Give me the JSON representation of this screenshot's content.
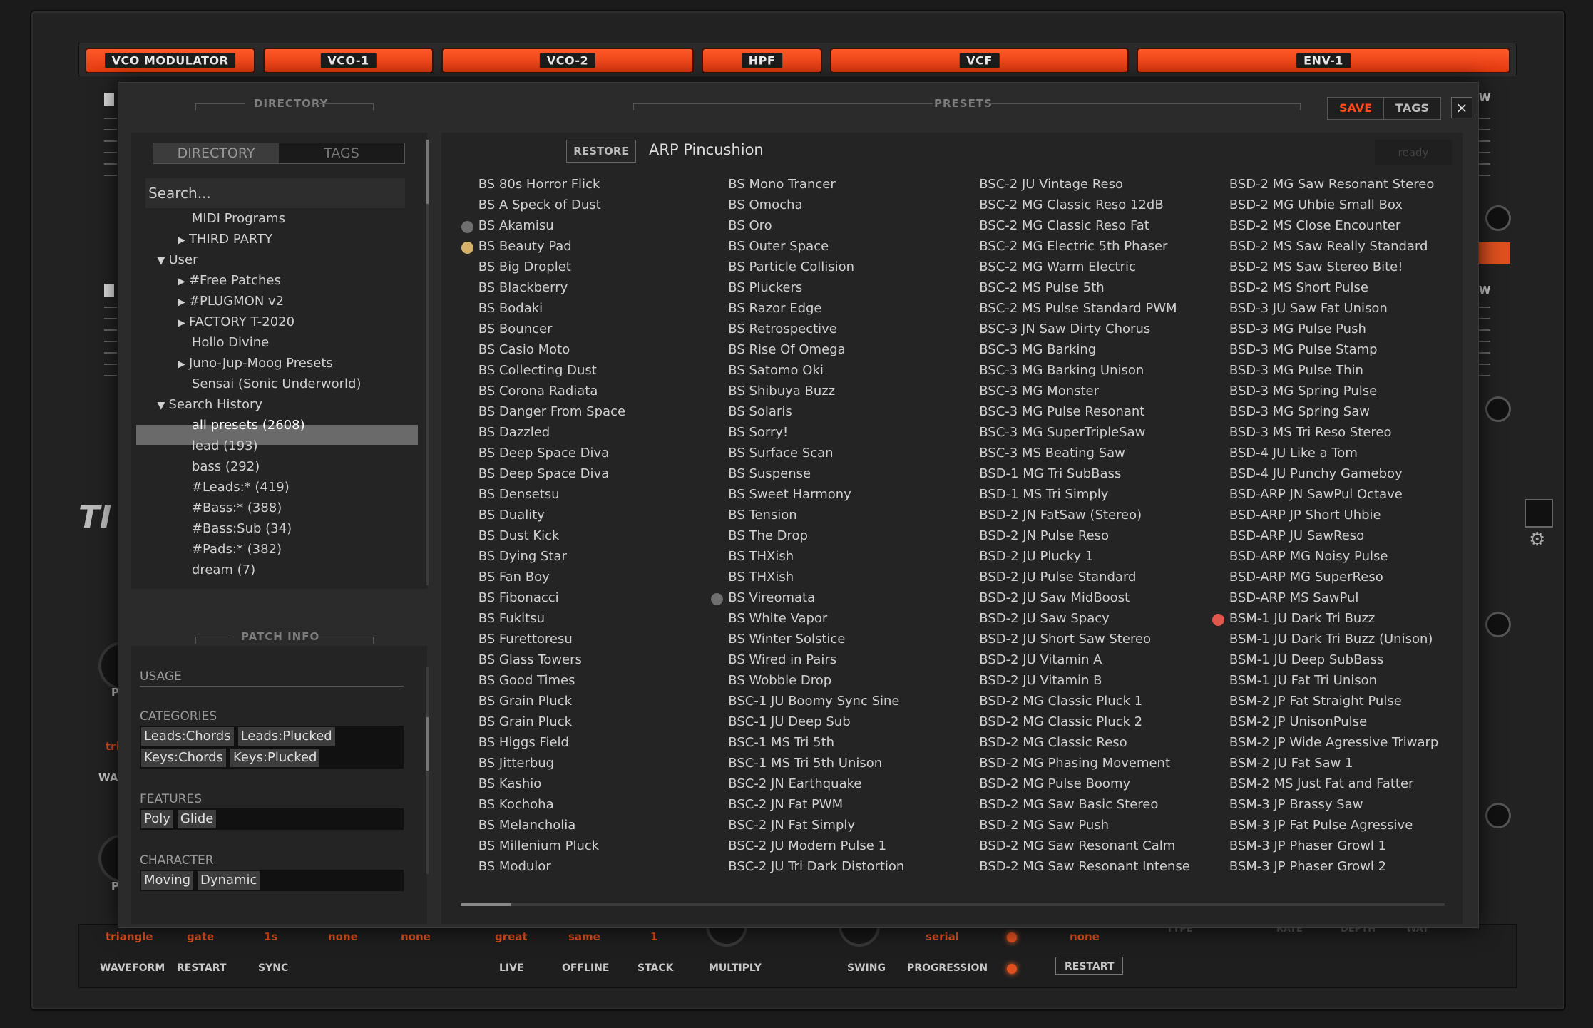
{
  "module_tabs": [
    "VCO MODULATOR",
    "VCO-1",
    "VCO-2",
    "HPF",
    "VCF",
    "ENV-1"
  ],
  "background": {
    "side_letters": [
      "W",
      "W"
    ],
    "left_wave_labels": [
      "tri",
      "WA",
      "P",
      "P"
    ],
    "bottom_values": [
      "triangle",
      "gate",
      "1s",
      "none",
      "none",
      "great",
      "same",
      "1",
      "serial",
      "none"
    ],
    "bottom_labels": [
      "WAVEFORM",
      "RESTART",
      "SYNC",
      "LIVE",
      "OFFLINE",
      "STACK",
      "MULTIPLY",
      "SWING",
      "PROGRESSION",
      "RESTART"
    ],
    "right_labels": [
      "TYPE",
      "RATE",
      "DEPTH",
      "WAY"
    ]
  },
  "browser": {
    "directory_title": "DIRECTORY",
    "presets_title": "PRESETS",
    "patch_info_title": "PATCH INFO",
    "save_label": "SAVE",
    "tags_label": "TAGS",
    "close_label": "×",
    "dir_tab_directory": "DIRECTORY",
    "dir_tab_tags": "TAGS",
    "search_placeholder": "Search...",
    "tree": [
      {
        "label": "MIDI Programs",
        "arrow": ""
      },
      {
        "label": "THIRD PARTY",
        "arrow": "▶"
      },
      {
        "label": "User",
        "arrow": "▼"
      },
      {
        "label": "#Free Patches",
        "arrow": "▶"
      },
      {
        "label": "#PLUGMON v2",
        "arrow": "▶"
      },
      {
        "label": "FACTORY T-2020",
        "arrow": "▶"
      },
      {
        "label": "Hollo Divine",
        "arrow": ""
      },
      {
        "label": "Juno-Jup-Moog Presets",
        "arrow": "▶"
      },
      {
        "label": "Sensai (Sonic Underworld)",
        "arrow": ""
      },
      {
        "label": "Search History",
        "arrow": "▼"
      },
      {
        "label": "all presets (2608)",
        "arrow": ""
      },
      {
        "label": "lead (193)",
        "arrow": ""
      },
      {
        "label": "bass (292)",
        "arrow": ""
      },
      {
        "label": "#Leads:* (419)",
        "arrow": ""
      },
      {
        "label": "#Bass:* (388)",
        "arrow": ""
      },
      {
        "label": "#Bass:Sub (34)",
        "arrow": ""
      },
      {
        "label": "#Pads:* (382)",
        "arrow": ""
      },
      {
        "label": "dream (7)",
        "arrow": ""
      }
    ],
    "patch_info": {
      "usage_label": "USAGE",
      "categories_label": "CATEGORIES",
      "categories": [
        "Leads:Chords",
        "Leads:Plucked",
        "Keys:Chords",
        "Keys:Plucked"
      ],
      "features_label": "FEATURES",
      "features": [
        "Poly",
        "Glide"
      ],
      "character_label": "CHARACTER",
      "character": [
        "Moving",
        "Dynamic"
      ]
    },
    "restore_label": "RESTORE",
    "current_preset": "ARP Pincushion",
    "status": "ready",
    "columns": [
      [
        "BS 80s Horror Flick",
        "BS A Speck of Dust",
        "BS Akamisu",
        "BS Beauty Pad",
        "BS Big Droplet",
        "BS Blackberry",
        "BS Bodaki",
        "BS Bouncer",
        "BS Casio Moto",
        "BS Collecting Dust",
        "BS Corona Radiata",
        "BS Danger From Space",
        "BS Dazzled",
        "BS Deep Space Diva",
        "BS Deep Space Diva",
        "BS Densetsu",
        "BS Duality",
        "BS Dust Kick",
        "BS Dying Star",
        "BS Fan Boy",
        "BS Fibonacci",
        "BS Fukitsu",
        "BS Furettoresu",
        "BS Glass Towers",
        "BS Good Times",
        "BS Grain Pluck",
        "BS Grain Pluck",
        "BS Higgs Field",
        "BS Jitterbug",
        "BS Kashio",
        "BS Kochoha",
        "BS Melancholia",
        "BS Millenium Pluck",
        "BS Modulor"
      ],
      [
        "BS Mono Trancer",
        "BS Omocha",
        "BS Oro",
        "BS Outer Space",
        "BS Particle Collision",
        "BS Pluckers",
        "BS Razor Edge",
        "BS Retrospective",
        "BS Rise Of Omega",
        "BS Satomo Oki",
        "BS Shibuya Buzz",
        "BS Solaris",
        "BS Sorry!",
        "BS Surface Scan",
        "BS Suspense",
        "BS Sweet Harmony",
        "BS Tension",
        "BS The Drop",
        "BS THXish",
        "BS THXish",
        "BS Vireomata",
        "BS White Vapor",
        "BS Winter Solstice",
        "BS Wired in Pairs",
        "BS Wobble Drop",
        "BSC-1 JU Boomy Sync Sine",
        "BSC-1 JU Deep Sub",
        "BSC-1 MS Tri 5th",
        "BSC-1 MS Tri 5th Unison",
        "BSC-2 JN Earthquake",
        "BSC-2 JN Fat PWM",
        "BSC-2 JN Fat Simply",
        "BSC-2 JU Modern Pulse 1",
        "BSC-2 JU Tri Dark Distortion"
      ],
      [
        "BSC-2 JU Vintage Reso",
        "BSC-2 MG Classic Reso 12dB",
        "BSC-2 MG Classic Reso Fat",
        "BSC-2 MG Electric 5th Phaser",
        "BSC-2 MG Warm Electric",
        "BSC-2 MS Pulse 5th",
        "BSC-2 MS Pulse Standard PWM",
        "BSC-3 JN Saw Dirty Chorus",
        "BSC-3 MG Barking",
        "BSC-3 MG Barking Unison",
        "BSC-3 MG Monster",
        "BSC-3 MG Pulse Resonant",
        "BSC-3 MG SuperTripleSaw",
        "BSC-3 MS Beating Saw",
        "BSD-1 MG Tri SubBass",
        "BSD-1 MS Tri Simply",
        "BSD-2 JN FatSaw (Stereo)",
        "BSD-2 JN Pulse Reso",
        "BSD-2 JU Plucky 1",
        "BSD-2 JU Pulse Standard",
        "BSD-2 JU Saw MidBoost",
        "BSD-2 JU Saw Spacy",
        "BSD-2 JU Short Saw Stereo",
        "BSD-2 JU Vitamin A",
        "BSD-2 JU Vitamin B",
        "BSD-2 MG Classic Pluck 1",
        "BSD-2 MG Classic Pluck 2",
        "BSD-2 MG Classic Reso",
        "BSD-2 MG Phasing Movement",
        "BSD-2 MG Pulse Boomy",
        "BSD-2 MG Saw Basic Stereo",
        "BSD-2 MG Saw Push",
        "BSD-2 MG Saw Resonant Calm",
        "BSD-2 MG Saw Resonant Intense"
      ],
      [
        "BSD-2 MG Saw Resonant Stereo",
        "BSD-2 MG Uhbie Small Box",
        "BSD-2 MS Close Encounter",
        "BSD-2 MS Saw Really Standard",
        "BSD-2 MS Saw Stereo Bite!",
        "BSD-2 MS Short Pulse",
        "BSD-3 JU Saw Fat Unison",
        "BSD-3 MG Pulse Push",
        "BSD-3 MG Pulse Stamp",
        "BSD-3 MG Pulse Thin",
        "BSD-3 MG Spring Pulse",
        "BSD-3 MG Spring Saw",
        "BSD-3 MS Tri Reso Stereo",
        "BSD-4 JU Like a Tom",
        "BSD-4 JU Punchy Gameboy",
        "BSD-ARP JN SawPul Octave",
        "BSD-ARP JP Short Uhbie",
        "BSD-ARP JU SawReso",
        "BSD-ARP MG Noisy Pulse",
        "BSD-ARP MG SuperReso",
        "BSD-ARP MS SawPul",
        "BSM-1 JU Dark Tri Buzz",
        "BSM-1 JU Dark Tri Buzz (Unison)",
        "BSM-1 JU Deep SubBass",
        "BSM-1 JU Fat Tri Unison",
        "BSM-2 JP Fat Straight Pulse",
        "BSM-2 JP UnisonPulse",
        "BSM-2 JP Wide Agressive Triwarp",
        "BSM-2 JU Fat Saw 1",
        "BSM-2 MS Just Fat and Fatter",
        "BSM-3 JP Brassy Saw",
        "BSM-3 JP Fat Pulse Agressive",
        "BSM-3 JP Phaser Growl 1",
        "BSM-3 JP Phaser Growl 2"
      ]
    ],
    "dot_colors": {
      "grey": "#6f6f6f",
      "gold": "#d6b16a",
      "red": "#e2574c"
    }
  }
}
